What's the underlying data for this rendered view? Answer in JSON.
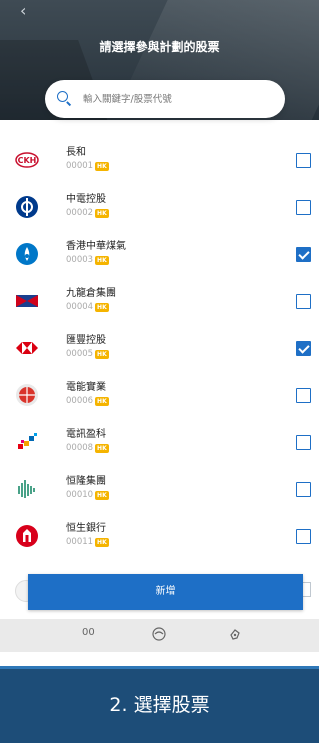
{
  "header": {
    "title": "請選擇參與計劃的股票",
    "back_icon": "chevron-left-icon"
  },
  "search": {
    "placeholder": "輸入關鍵字/股票代號",
    "icon": "search-icon"
  },
  "stocks": [
    {
      "name": "長和",
      "code": "00001",
      "badge": "HK",
      "checked": false,
      "logo": "ckh-logo"
    },
    {
      "name": "中電控股",
      "code": "00002",
      "badge": "HK",
      "checked": false,
      "logo": "clp-logo"
    },
    {
      "name": "香港中華煤氣",
      "code": "00003",
      "badge": "HK",
      "checked": true,
      "logo": "towngas-logo"
    },
    {
      "name": "九龍倉集團",
      "code": "00004",
      "badge": "HK",
      "checked": false,
      "logo": "wharf-logo"
    },
    {
      "name": "匯豐控股",
      "code": "00005",
      "badge": "HK",
      "checked": true,
      "logo": "hsbc-logo"
    },
    {
      "name": "電能實業",
      "code": "00006",
      "badge": "HK",
      "checked": false,
      "logo": "power-assets-logo"
    },
    {
      "name": "電訊盈科",
      "code": "00008",
      "badge": "HK",
      "checked": false,
      "logo": "pccw-logo"
    },
    {
      "name": "恒隆集團",
      "code": "00010",
      "badge": "HK",
      "checked": false,
      "logo": "hang-lung-logo"
    },
    {
      "name": "恒生銀行",
      "code": "00011",
      "badge": "HK",
      "checked": false,
      "logo": "hang-seng-logo"
    }
  ],
  "add_button": {
    "label": "新增"
  },
  "bottom_nav": {
    "items": [
      "00",
      "face-icon",
      "hand-icon"
    ],
    "first_label": "00"
  },
  "banner": {
    "label": "2. 選擇股票"
  },
  "colors": {
    "accent": "#1e6fc6",
    "banner": "#1d4d78",
    "hk_badge": "#f5b400"
  }
}
